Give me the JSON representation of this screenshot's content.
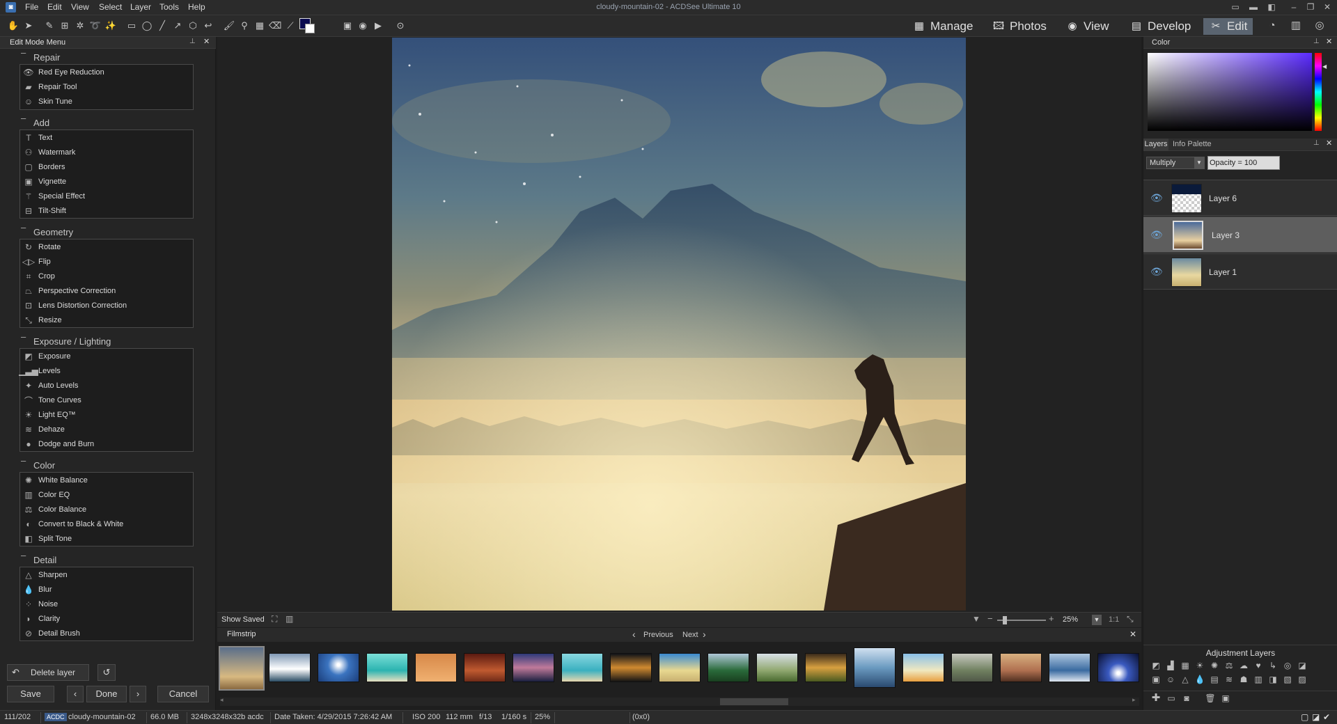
{
  "window": {
    "title": "cloudy-mountain-02 - ACDSee Ultimate 10",
    "menu": [
      "File",
      "Edit",
      "View",
      "Select",
      "Layer",
      "Tools",
      "Help"
    ]
  },
  "modes": [
    {
      "label": "Manage",
      "icon": "grid-icon"
    },
    {
      "label": "Photos",
      "icon": "photos-icon"
    },
    {
      "label": "View",
      "icon": "eye-icon"
    },
    {
      "label": "Develop",
      "icon": "develop-icon"
    },
    {
      "label": "Edit",
      "icon": "edit-icon",
      "active": true
    }
  ],
  "left_panel": {
    "title": "Edit Mode Menu",
    "groups": [
      {
        "title": "Repair",
        "items": [
          "Red Eye Reduction",
          "Repair Tool",
          "Skin Tune"
        ]
      },
      {
        "title": "Add",
        "items": [
          "Text",
          "Watermark",
          "Borders",
          "Vignette",
          "Special Effect",
          "Tilt-Shift"
        ]
      },
      {
        "title": "Geometry",
        "items": [
          "Rotate",
          "Flip",
          "Crop",
          "Perspective Correction",
          "Lens Distortion Correction",
          "Resize"
        ]
      },
      {
        "title": "Exposure / Lighting",
        "items": [
          "Exposure",
          "Levels",
          "Auto Levels",
          "Tone Curves",
          "Light EQ™",
          "Dehaze",
          "Dodge and Burn"
        ]
      },
      {
        "title": "Color",
        "items": [
          "White Balance",
          "Color EQ",
          "Color Balance",
          "Convert to Black & White",
          "Split Tone"
        ]
      },
      {
        "title": "Detail",
        "items": [
          "Sharpen",
          "Blur",
          "Noise",
          "Clarity",
          "Detail Brush"
        ]
      }
    ],
    "delete_layer": "Delete layer",
    "save": "Save",
    "done": "Done",
    "cancel": "Cancel"
  },
  "canvas_toolbar": {
    "show_saved": "Show Saved",
    "zoom": "25%",
    "one_to_one": "1:1"
  },
  "filmstrip": {
    "title": "Filmstrip",
    "previous": "Previous",
    "next": "Next"
  },
  "right_panel": {
    "color_title": "Color",
    "tabs": [
      "Layers",
      "Info Palette"
    ],
    "blend_mode": "Multiply",
    "opacity": "Opacity = 100",
    "layers": [
      {
        "name": "Layer 6",
        "selected": false
      },
      {
        "name": "Layer 3",
        "selected": true
      },
      {
        "name": "Layer 1",
        "selected": false
      }
    ],
    "adjustment_layers_title": "Adjustment Layers"
  },
  "status": {
    "index": "111/202",
    "format_badge": "ACDC",
    "filename": "cloudy-mountain-02",
    "size": "66.0 MB",
    "dimensions": "3248x3248x32b acdc",
    "date_taken": "Date Taken: 4/29/2015 7:26:42 AM",
    "iso": "ISO 200",
    "focal": "112 mm",
    "aperture": "f/13",
    "shutter": "1/160 s",
    "zoom": "25%",
    "coords": "(0x0)"
  }
}
